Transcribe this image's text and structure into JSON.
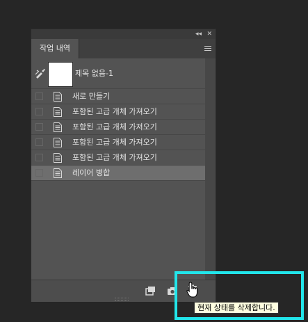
{
  "panel": {
    "title_controls": {
      "collapse": "◂◂",
      "close": "✕"
    },
    "tab_label": "작업 내역",
    "snapshot": {
      "label": "제목 없음-1"
    },
    "items": [
      {
        "label": "새로 만들기"
      },
      {
        "label": "포함된 고급 개체 가져오기"
      },
      {
        "label": "포함된 고급 개체 가져오기"
      },
      {
        "label": "포함된 고급 개체 가져오기"
      },
      {
        "label": "포함된 고급 개체 가져오기"
      },
      {
        "label": "레이어 병합"
      }
    ],
    "selected_index": 5
  },
  "tooltip": {
    "text": "현재 상태를 삭제합니다."
  },
  "colors": {
    "highlight": "#22e5ea",
    "panel": "#535353",
    "selected_row": "#6e6e6e"
  }
}
